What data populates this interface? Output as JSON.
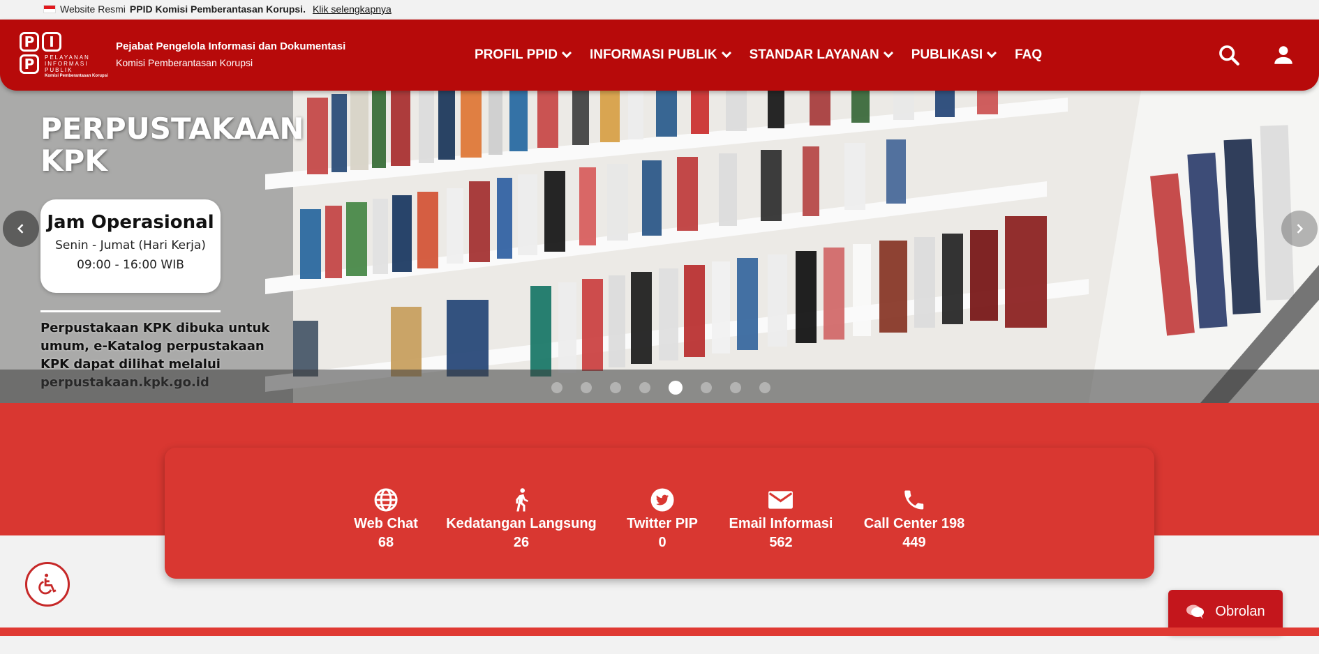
{
  "topbar": {
    "prefix": "Website Resmi",
    "site_name": "PPID Komisi Pemberantasan Korupsi.",
    "link": "Klik selengkapnya"
  },
  "logo": {
    "letters": [
      "P",
      "I",
      "P"
    ],
    "line1": "PELAYANAN",
    "line2": "INFORMASI",
    "line3": "PUBLIK",
    "org": "Komisi Pemberantasan Korupsi"
  },
  "header": {
    "title": "Pejabat Pengelola Informasi dan Dokumentasi",
    "subtitle": "Komisi Pemberantasan Korupsi"
  },
  "nav": {
    "items": [
      {
        "label": "PROFIL PPID",
        "dropdown": true
      },
      {
        "label": "INFORMASI PUBLIK",
        "dropdown": true
      },
      {
        "label": "STANDAR LAYANAN",
        "dropdown": true
      },
      {
        "label": "PUBLIKASI",
        "dropdown": true
      },
      {
        "label": "FAQ",
        "dropdown": false
      }
    ],
    "search_icon": "search-icon",
    "account_icon": "account-icon"
  },
  "hero": {
    "title_line1": "PERPUSTAKAAN",
    "title_line2": "KPK",
    "card": {
      "title": "Jam Operasional",
      "days": "Senin - Jumat (Hari Kerja)",
      "hours": "09:00 - 16:00 WIB"
    },
    "description": "Perpustakaan KPK dibuka untuk umum,  e-Katalog perpustakaan KPK dapat dilihat melalui perpustakaan.kpk.go.id",
    "slide_count": 8,
    "active_slide": 5
  },
  "stats": [
    {
      "label": "Web Chat",
      "value": "68",
      "icon": "globe-icon"
    },
    {
      "label": "Kedatangan Langsung",
      "value": "26",
      "icon": "walking-icon"
    },
    {
      "label": "Twitter PIP",
      "value": "0",
      "icon": "twitter-icon"
    },
    {
      "label": "Email Informasi",
      "value": "562",
      "icon": "email-icon"
    },
    {
      "label": "Call Center 198",
      "value": "449",
      "icon": "phone-icon"
    }
  ],
  "chat": {
    "label": "Obrolan"
  },
  "colors": {
    "header": "#b70a0a",
    "band": "#d93731",
    "chat": "#c4161c"
  }
}
